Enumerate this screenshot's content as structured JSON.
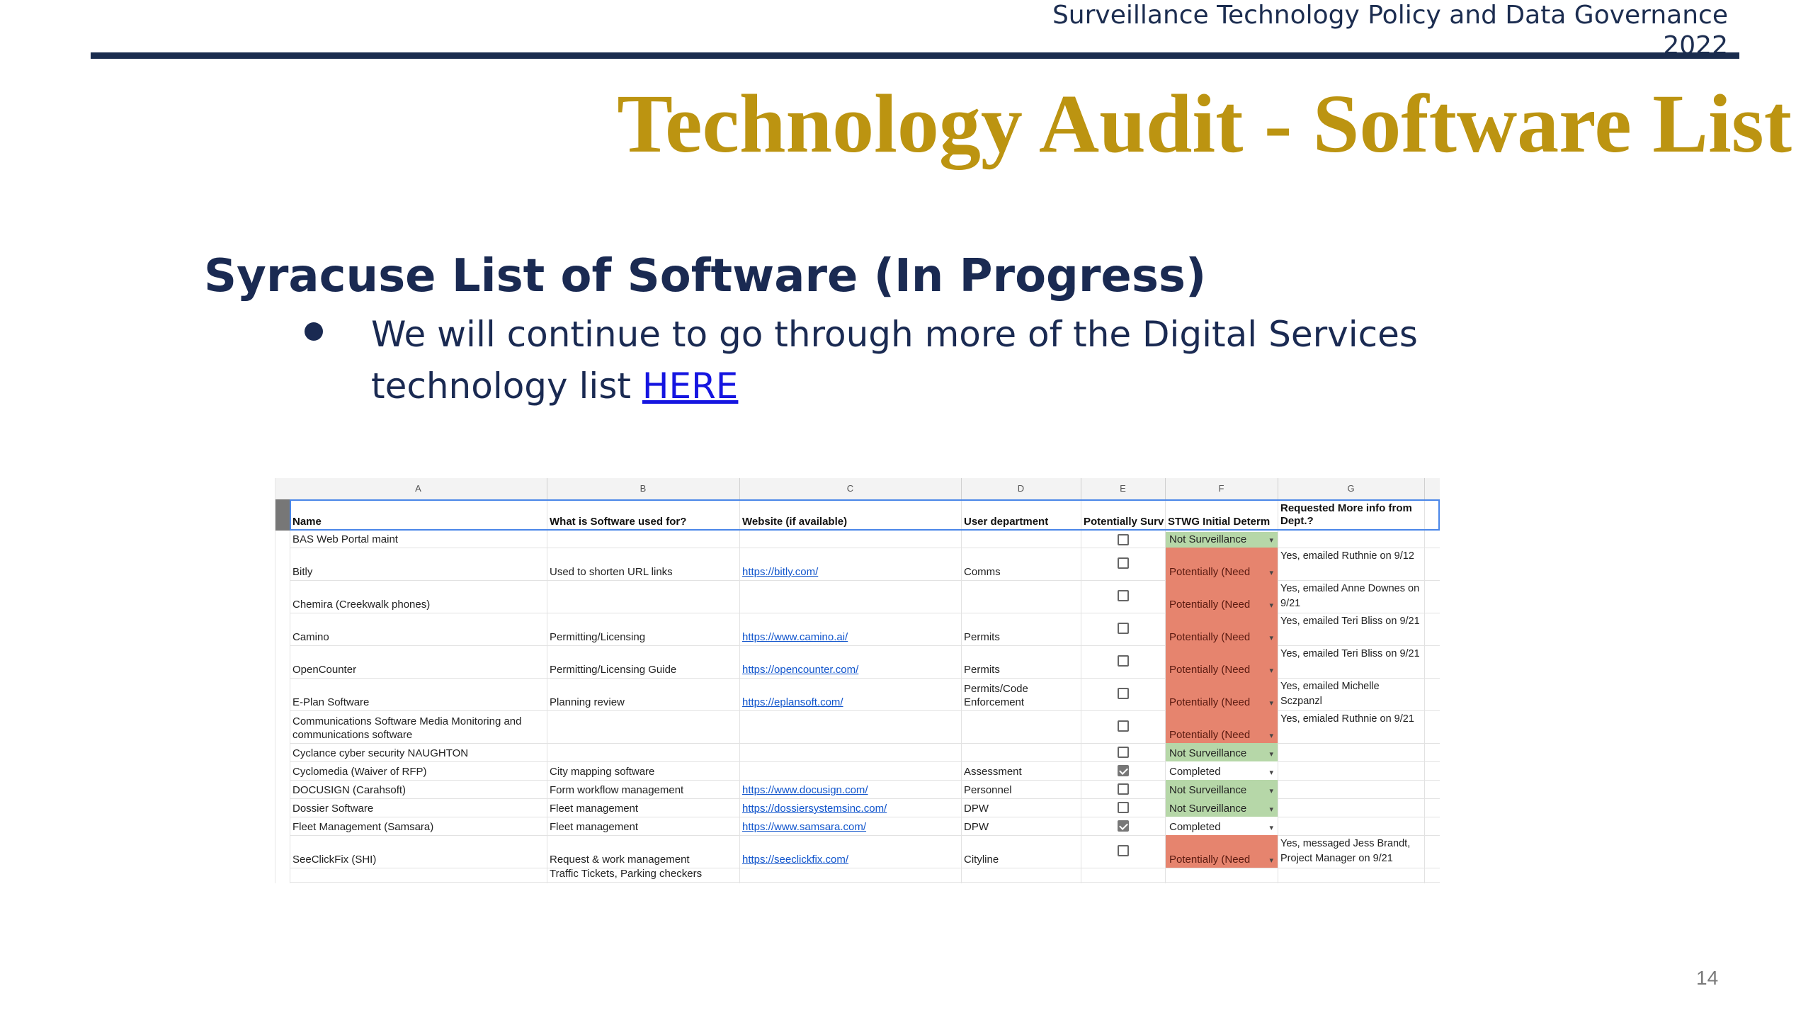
{
  "header": {
    "line1": "Surveillance Technology Policy and Data Governance",
    "line2": "2022"
  },
  "title": "Technology Audit - Software List",
  "subtitle": "Syracuse List of Software (In Progress)",
  "bullet": {
    "text": "We will continue to go through more of the Digital Services technology list ",
    "link": "HERE"
  },
  "sheet": {
    "column_letters": [
      "A",
      "B",
      "C",
      "D",
      "E",
      "F",
      "G"
    ],
    "headers": [
      "Name",
      "What is Software used for?",
      "Website (if available)",
      "User department",
      "Potentially Surv",
      "STWG Initial Determ",
      "Requested More info from Dept.?"
    ],
    "rows": [
      {
        "name": "BAS Web Portal maint",
        "use": "",
        "website": "",
        "dept": "",
        "checked": false,
        "status": "Not Surveillance",
        "status_type": "green",
        "info": ""
      },
      {
        "name": "Bitly",
        "use": "Used to shorten URL links",
        "website": "https://bitly.com/",
        "dept": "Comms",
        "checked": false,
        "status": "Potentially (Need",
        "status_type": "red",
        "info": "Yes, emailed Ruthnie on 9/12"
      },
      {
        "name": "Chemira (Creekwalk phones)",
        "use": "",
        "website": "",
        "dept": "",
        "checked": false,
        "status": "Potentially (Need",
        "status_type": "red",
        "info": "Yes, emailed Anne Downes on 9/21"
      },
      {
        "name": "Camino",
        "use": "Permitting/Licensing",
        "website": "https://www.camino.ai/",
        "dept": "Permits",
        "checked": false,
        "status": "Potentially (Need",
        "status_type": "red",
        "info": "Yes, emailed Teri Bliss on 9/21"
      },
      {
        "name": "OpenCounter",
        "use": "Permitting/Licensing Guide",
        "website": "https://opencounter.com/",
        "dept": "Permits",
        "checked": false,
        "status": "Potentially (Need",
        "status_type": "red",
        "info": "Yes, emailed Teri Bliss on 9/21"
      },
      {
        "name": "E-Plan Software",
        "use": "Planning review",
        "website": "https://eplansoft.com/",
        "dept": "Permits/Code Enforcement",
        "checked": false,
        "status": "Potentially (Need",
        "status_type": "red",
        "info": "Yes, emailed Michelle Sczpanzl"
      },
      {
        "name": "Communications Software Media Monitoring and communications software",
        "use": "",
        "website": "",
        "dept": "",
        "checked": false,
        "status": "Potentially (Need",
        "status_type": "red",
        "info": "Yes, emialed Ruthnie on 9/21"
      },
      {
        "name": "Cyclance cyber security NAUGHTON",
        "use": "",
        "website": "",
        "dept": "",
        "checked": false,
        "status": "Not Surveillance",
        "status_type": "green",
        "info": ""
      },
      {
        "name": "Cyclomedia (Waiver of RFP)",
        "use": "City mapping software",
        "website": "",
        "dept": "Assessment",
        "checked": true,
        "status": "Completed",
        "status_type": "plain",
        "info": ""
      },
      {
        "name": "DOCUSIGN (Carahsoft)",
        "use": "Form workflow management",
        "website": "https://www.docusign.com/",
        "dept": "Personnel",
        "checked": false,
        "status": "Not Surveillance",
        "status_type": "green",
        "info": ""
      },
      {
        "name": "Dossier Software",
        "use": "Fleet management",
        "website": "https://dossiersystemsinc.com/",
        "dept": "DPW",
        "checked": false,
        "status": "Not Surveillance",
        "status_type": "green",
        "info": ""
      },
      {
        "name": "Fleet Management (Samsara)",
        "use": "Fleet management",
        "website": "https://www.samsara.com/",
        "dept": "DPW",
        "checked": true,
        "status": "Completed",
        "status_type": "plain",
        "info": ""
      },
      {
        "name": "SeeClickFix (SHI)",
        "use": "Request & work management",
        "website": "https://seeclickfix.com/",
        "dept": "Cityline",
        "checked": false,
        "status": "Potentially (Need",
        "status_type": "red",
        "info": "Yes, messaged Jess Brandt, Project Manager on 9/21"
      },
      {
        "name": "",
        "use": "Traffic Tickets, Parking checkers",
        "website": "",
        "dept": "",
        "checked": false,
        "status": "",
        "status_type": "none",
        "info": ""
      }
    ]
  },
  "page_number": "14"
}
